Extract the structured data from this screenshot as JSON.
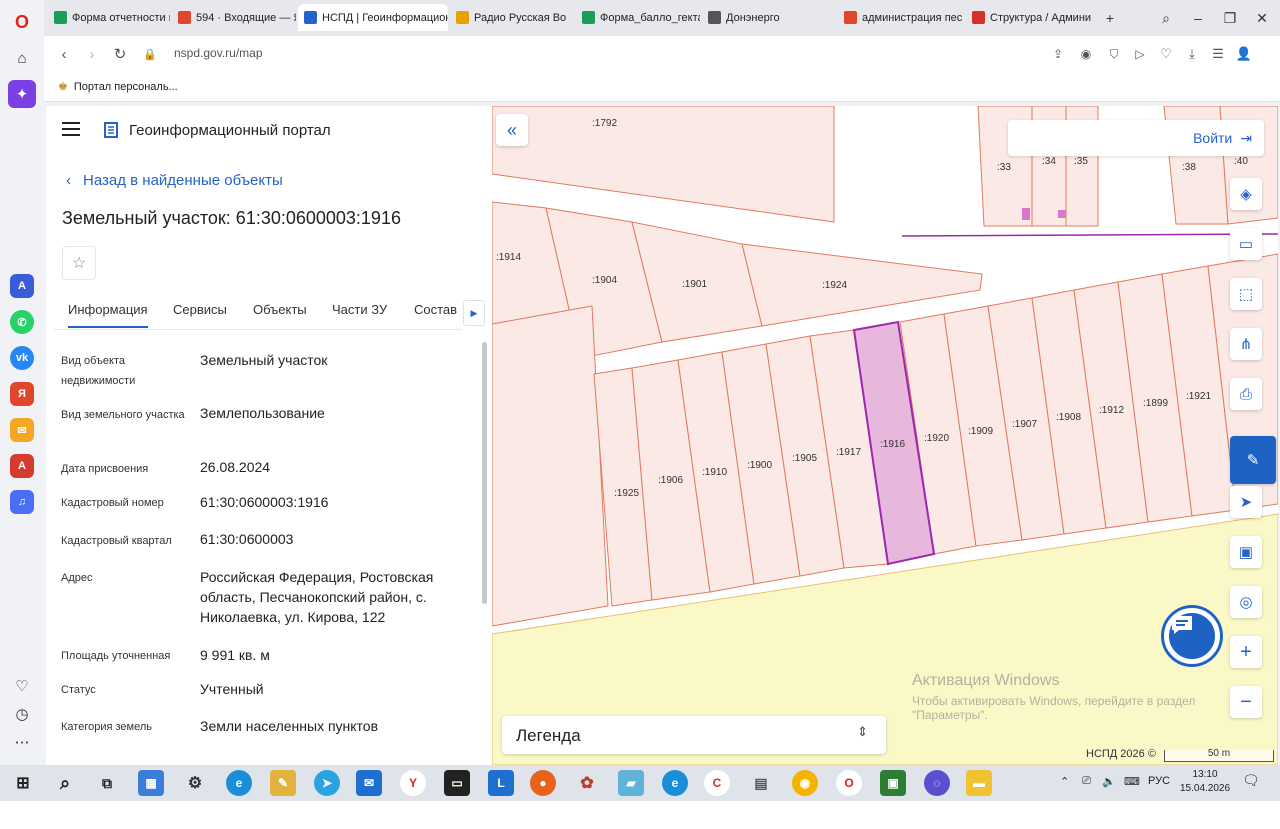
{
  "browser": {
    "tabs": [
      {
        "label": "Форма отчетности п",
        "color": "#1a9c5a"
      },
      {
        "label": "594 · Входящие — Я",
        "color": "#e0462b"
      },
      {
        "label": "НСПД | Геоинформацион",
        "color": "#2563c9",
        "active": true
      },
      {
        "label": "Радио Русская Во",
        "color": "#e8a200"
      },
      {
        "label": "Форма_балло_гекта",
        "color": "#1a9c5a"
      },
      {
        "label": "Донэнерго",
        "color": "#555555"
      },
      {
        "label": "администрация пес",
        "color": "#e0462b"
      },
      {
        "label": "Структура / Админи",
        "color": "#d4332b"
      }
    ],
    "url": "nspd.gov.ru/map",
    "bookmark": "Портал персональ..."
  },
  "panel": {
    "header_title": "Геоинформационный портал",
    "back_label": "Назад в найденные объекты",
    "title": "Земельный участок: 61:30:0600003:1916",
    "tabs": [
      "Информация",
      "Сервисы",
      "Объекты",
      "Части ЗУ",
      "Состав"
    ],
    "fields": [
      {
        "label": "Вид объекта недвижимости",
        "value": "Земельный участок"
      },
      {
        "label": "Вид земельного участка",
        "value": "Землепользование"
      },
      {
        "label": "Дата присвоения",
        "value": "26.08.2024"
      },
      {
        "label": "Кадастровый номер",
        "value": "61:30:0600003:1916"
      },
      {
        "label": "Кадастровый квартал",
        "value": "61:30:0600003"
      },
      {
        "label": "Адрес",
        "value": "Российская Федерация, Ростовская область, Песчанокопский район, с. Николаевка, ул. Кирова, 122"
      },
      {
        "label": "Площадь уточненная",
        "value": "9 991 кв. м"
      },
      {
        "label": "Статус",
        "value": "Учтенный"
      },
      {
        "label": "Категория земель",
        "value": "Земли населенных пунктов"
      }
    ]
  },
  "map": {
    "login_label": "Войти",
    "legend_label": "Легенда",
    "watermark_title": "Активация Windows",
    "watermark_text1": "Чтобы активировать Windows, перейдите в раздел",
    "watermark_text2": "\"Параметры\".",
    "copyright": "НСПД 2026 ©",
    "scale": "50 m",
    "parcel_labels": {
      "p1792": ":1792",
      "p33": ":33",
      "p34": ":34",
      "p35": ":35",
      "p38": ":38",
      "p40": ":40",
      "p1914": ":1914",
      "p1904": ":1904",
      "p1901": ":1901",
      "p1924": ":1924",
      "p1925": ":1925",
      "p1906": ":1906",
      "p1910": ":1910",
      "p1900": ":1900",
      "p1905": ":1905",
      "p1917": ":1917",
      "p1916": ":1916",
      "p1920": ":1920",
      "p1909": ":1909",
      "p1907": ":1907",
      "p1908": ":1908",
      "p1912": ":1912",
      "p1899": ":1899",
      "p1921": ":1921"
    },
    "colors": {
      "parcel_fill": "#fbe9e6",
      "parcel_stroke": "#e07a5f",
      "selected_fill": "#e8b7dc",
      "selected_stroke": "#9c27b0",
      "field_fill": "#fbf8c8"
    }
  },
  "taskbar": {
    "lang": "РУС",
    "time": "13:10",
    "date": "15.04.2026"
  }
}
